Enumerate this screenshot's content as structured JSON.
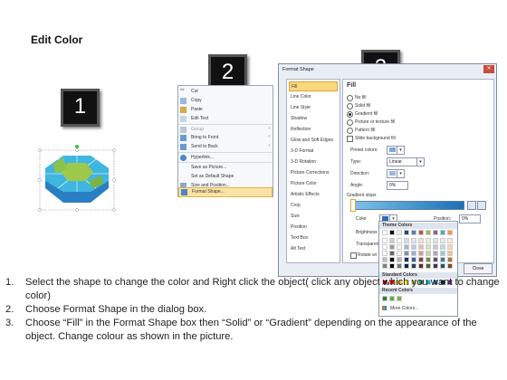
{
  "title": "Edit Color",
  "step_numbers": [
    "1",
    "2",
    "3"
  ],
  "context_menu": {
    "items": [
      {
        "label": "Cut",
        "icon": "scissors-icon",
        "arrow": ""
      },
      {
        "label": "Copy",
        "icon": "copy-icon",
        "arrow": ""
      },
      {
        "label": "Paste",
        "icon": "paste-icon",
        "arrow": ""
      },
      {
        "label": "Edit Text",
        "icon": "edit-text-icon",
        "arrow": ""
      },
      {
        "label": "Group",
        "icon": "group-icon",
        "arrow": "›"
      },
      {
        "label": "Bring to Front",
        "icon": "bring-front-icon",
        "arrow": "›"
      },
      {
        "label": "Send to Back",
        "icon": "send-back-icon",
        "arrow": "›"
      },
      {
        "label": "Hyperlink...",
        "icon": "hyperlink-icon",
        "arrow": ""
      },
      {
        "label": "Save as Picture...",
        "icon": "",
        "arrow": ""
      },
      {
        "label": "Set as Default Shape",
        "icon": "",
        "arrow": ""
      },
      {
        "label": "Size and Position...",
        "icon": "size-icon",
        "arrow": ""
      },
      {
        "label": "Format Shape...",
        "icon": "format-shape-icon",
        "arrow": ""
      }
    ],
    "selected_index": 11
  },
  "dialog": {
    "title": "Format Shape",
    "close_glyph": "✕",
    "nav": [
      "Fill",
      "Line Color",
      "Line Style",
      "Shadow",
      "Reflection",
      "Glow and Soft Edges",
      "3-D Format",
      "3-D Rotation",
      "Picture Corrections",
      "Picture Color",
      "Artistic Effects",
      "Crop",
      "Size",
      "Position",
      "Text Box",
      "Alt Text"
    ],
    "nav_selected": 0,
    "pane": {
      "heading": "Fill",
      "options": [
        "No fill",
        "Solid fill",
        "Gradient fill",
        "Picture or texture fill",
        "Pattern fill"
      ],
      "selected_option": 2,
      "slide_bg_label": "Slide background fill",
      "preset_label": "Preset colors:",
      "type_label": "Type:",
      "type_value": "Linear",
      "direction_label": "Direction:",
      "angle_label": "Angle:",
      "angle_value": "0%",
      "gradient_stops_label": "Gradient stops",
      "color_label": "Color",
      "position_label": "Position:",
      "position_value": "0%",
      "brightness_label": "Brightness",
      "transparency_label": "Transparency",
      "rotate_label": "Rotate wi"
    },
    "close_button": "Close"
  },
  "palette": {
    "theme_label": "Theme Colors",
    "standard_label": "Standard Colors",
    "recent_label": "Recent Colors",
    "more_label": "More Colors...",
    "theme_top": [
      "#ffffff",
      "#000000",
      "#eeece1",
      "#1f497d",
      "#4f81bd",
      "#c0504d",
      "#9bbb59",
      "#8064a2",
      "#4bacc6",
      "#f79646"
    ],
    "standard": [
      "#c00000",
      "#ff0000",
      "#ffc000",
      "#ffff00",
      "#92d050",
      "#00b050",
      "#00b0f0",
      "#0070c0",
      "#002060",
      "#7030a0"
    ],
    "recent": [
      "#2e7d32",
      "#4caf50",
      "#7cb342"
    ]
  },
  "instructions": [
    {
      "num": "1.",
      "text": "Select the shape to change the color and Right click the object( click any object which you want to change color)"
    },
    {
      "num": "2.",
      "text": "Choose Format Shape in the dialog box."
    },
    {
      "num": "3.",
      "text": "Choose “Fill” in the Format Shape box then “Solid” or “Gradient” depending on the appearance of the object. Change colour as shown in the picture."
    }
  ]
}
